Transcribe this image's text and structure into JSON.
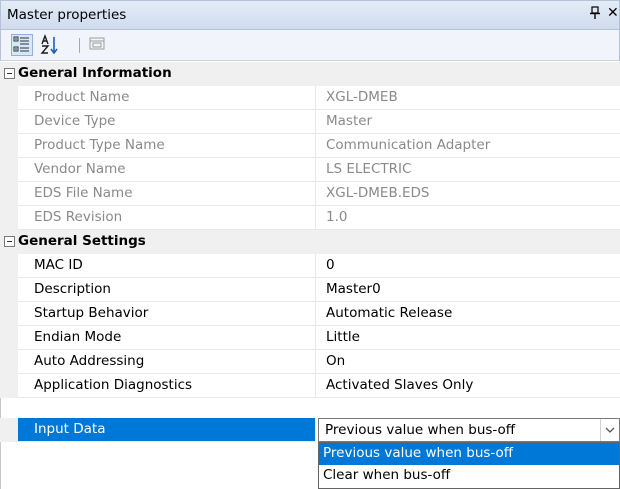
{
  "window": {
    "title": "Master properties",
    "close_glyph": "✕"
  },
  "toolbar": {
    "icons": [
      "categorized-icon",
      "sort-alphabetical-icon",
      "property-pages-icon"
    ]
  },
  "sections": [
    {
      "name": "General Information",
      "readonly": true,
      "rows": [
        {
          "name": "Product Name",
          "value": "XGL-DMEB"
        },
        {
          "name": "Device Type",
          "value": "Master"
        },
        {
          "name": "Product Type Name",
          "value": "Communication Adapter"
        },
        {
          "name": "Vendor Name",
          "value": "LS ELECTRIC"
        },
        {
          "name": "EDS File Name",
          "value": "XGL-DMEB.EDS"
        },
        {
          "name": "EDS Revision",
          "value": "1.0"
        }
      ]
    },
    {
      "name": "General Settings",
      "readonly": false,
      "rows": [
        {
          "name": "MAC ID",
          "value": "0"
        },
        {
          "name": "Description",
          "value": "Master0"
        },
        {
          "name": "Startup Behavior",
          "value": "Automatic Release"
        },
        {
          "name": "Endian Mode",
          "value": "Little"
        },
        {
          "name": "Auto Addressing",
          "value": "On"
        },
        {
          "name": "Application Diagnostics",
          "value": "Activated Slaves Only"
        },
        {
          "name": "Input Data",
          "value": "Previous value when bus-off"
        }
      ]
    }
  ],
  "dropdown": {
    "options": [
      "Previous value when bus-off",
      "Clear when bus-off"
    ],
    "highlighted": "Previous value when bus-off"
  },
  "colors": {
    "selection": "#0078d7",
    "readonly_text": "#8a8a8a",
    "category_bg": "#f0f0f0"
  }
}
